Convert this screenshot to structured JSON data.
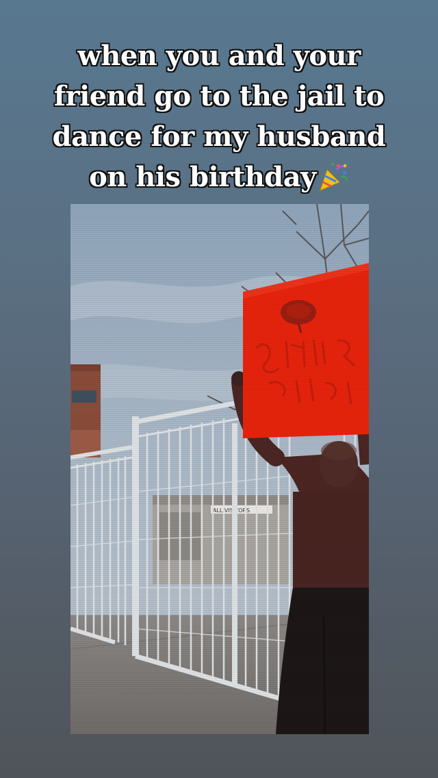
{
  "caption": {
    "lines": [
      "when you and your",
      "friend go to the jail to",
      "dance for my husband",
      "on his birthday"
    ],
    "emoji": "party-popper-icon"
  },
  "media": {
    "kind": "video-frame",
    "colors": {
      "sky": "#9fb1c4",
      "sign": "#e6230c",
      "fence": "#dcdfe2",
      "building": "#8a4c3a",
      "ground": "#7d7a78"
    }
  }
}
